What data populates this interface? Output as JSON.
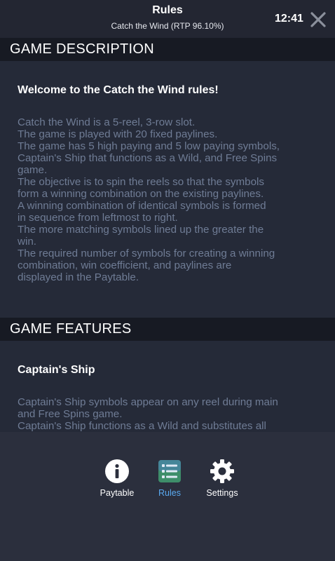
{
  "header": {
    "title": "Rules",
    "subtitle": "Catch the Wind (RTP 96.10%)",
    "time": "12:41",
    "close_icon": "close-icon"
  },
  "sections": [
    {
      "title": "GAME DESCRIPTION",
      "subheading": "Welcome to the Catch the Wind rules!",
      "lines": [
        "Catch the Wind is a 5-reel, 3-row slot.",
        "The game is played with 20 fixed paylines.",
        "The game has 5 high paying and 5 low paying symbols,",
        "Captain's Ship that functions as a Wild, and Free Spins",
        "game.",
        "The objective is to spin the reels so that the symbols",
        "form a winning combination on the existing paylines.",
        "A winning combination of identical symbols is formed",
        "in sequence from leftmost to right.",
        "The more matching symbols lined up the greater the",
        "win.",
        "The required number of symbols for creating a winning",
        "combination, win coefficient, and paylines are",
        "displayed in the Paytable."
      ]
    },
    {
      "title": "GAME FEATURES",
      "subheading": "Captain's Ship",
      "lines": [
        "Captain's Ship symbols appear on any reel during main",
        "and Free Spins game.",
        "Captain's Ship functions as a Wild and substitutes all"
      ]
    }
  ],
  "nav": {
    "paytable": {
      "label": "Paytable",
      "icon": "info-icon"
    },
    "rules": {
      "label": "Rules",
      "icon": "list-icon",
      "active": true
    },
    "settings": {
      "label": "Settings",
      "icon": "gear-icon"
    }
  },
  "colors": {
    "accent": "#5aa9f0",
    "background": "#252a38",
    "section_header": "#171a23",
    "body_text": "#6f7c95"
  }
}
